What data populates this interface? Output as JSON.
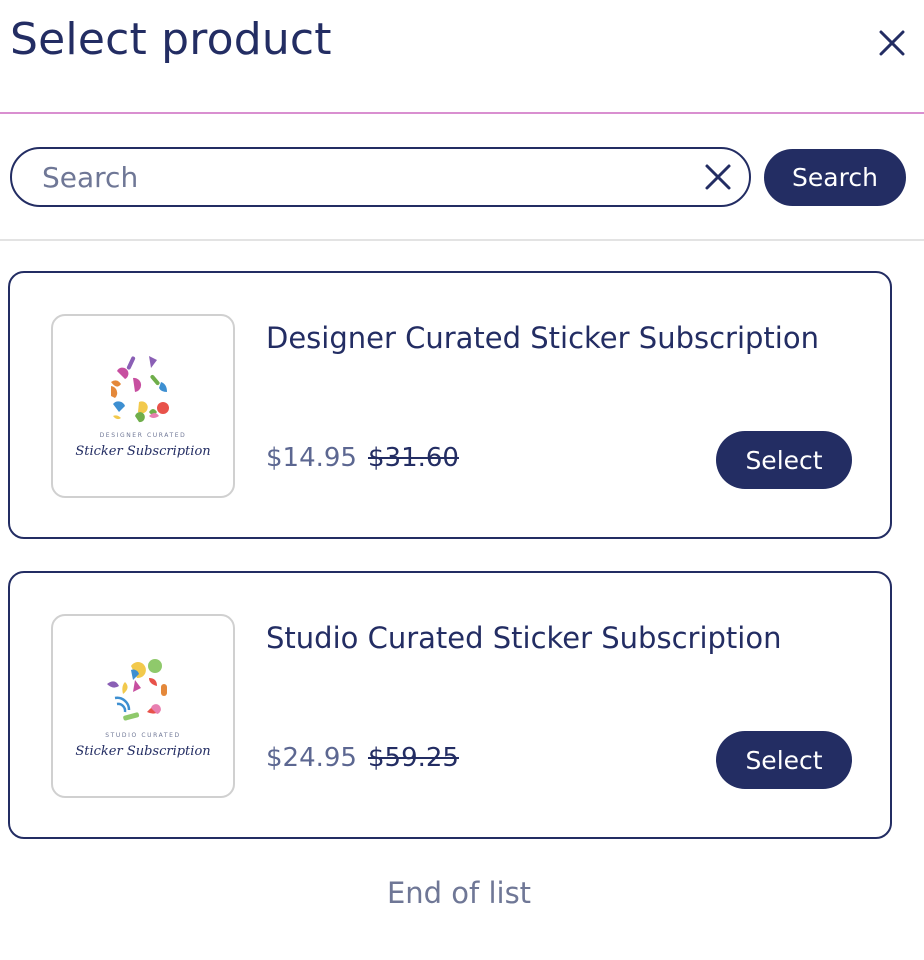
{
  "modal": {
    "title": "Select product",
    "close_icon": "close-icon"
  },
  "search": {
    "placeholder": "Search",
    "value": "",
    "clear_icon": "clear-icon",
    "button_label": "Search"
  },
  "products": [
    {
      "name": "Designer Curated Sticker Subscription",
      "price": "$14.95",
      "original_price": "$31.60",
      "select_label": "Select",
      "logo": {
        "caption": "DESIGNER CURATED",
        "script": "Sticker Subscription"
      }
    },
    {
      "name": "Studio Curated Sticker Subscription",
      "price": "$24.95",
      "original_price": "$59.25",
      "select_label": "Select",
      "logo": {
        "caption": "STUDIO CURATED",
        "script": "Sticker Subscription"
      }
    }
  ],
  "footer": {
    "end_of_list": "End of list"
  },
  "colors": {
    "primary": "#232d63",
    "header_divider": "#d98fd0",
    "muted_text": "#6f7796",
    "price_text": "#5c6791",
    "thumb_border": "#d0d0d0"
  }
}
